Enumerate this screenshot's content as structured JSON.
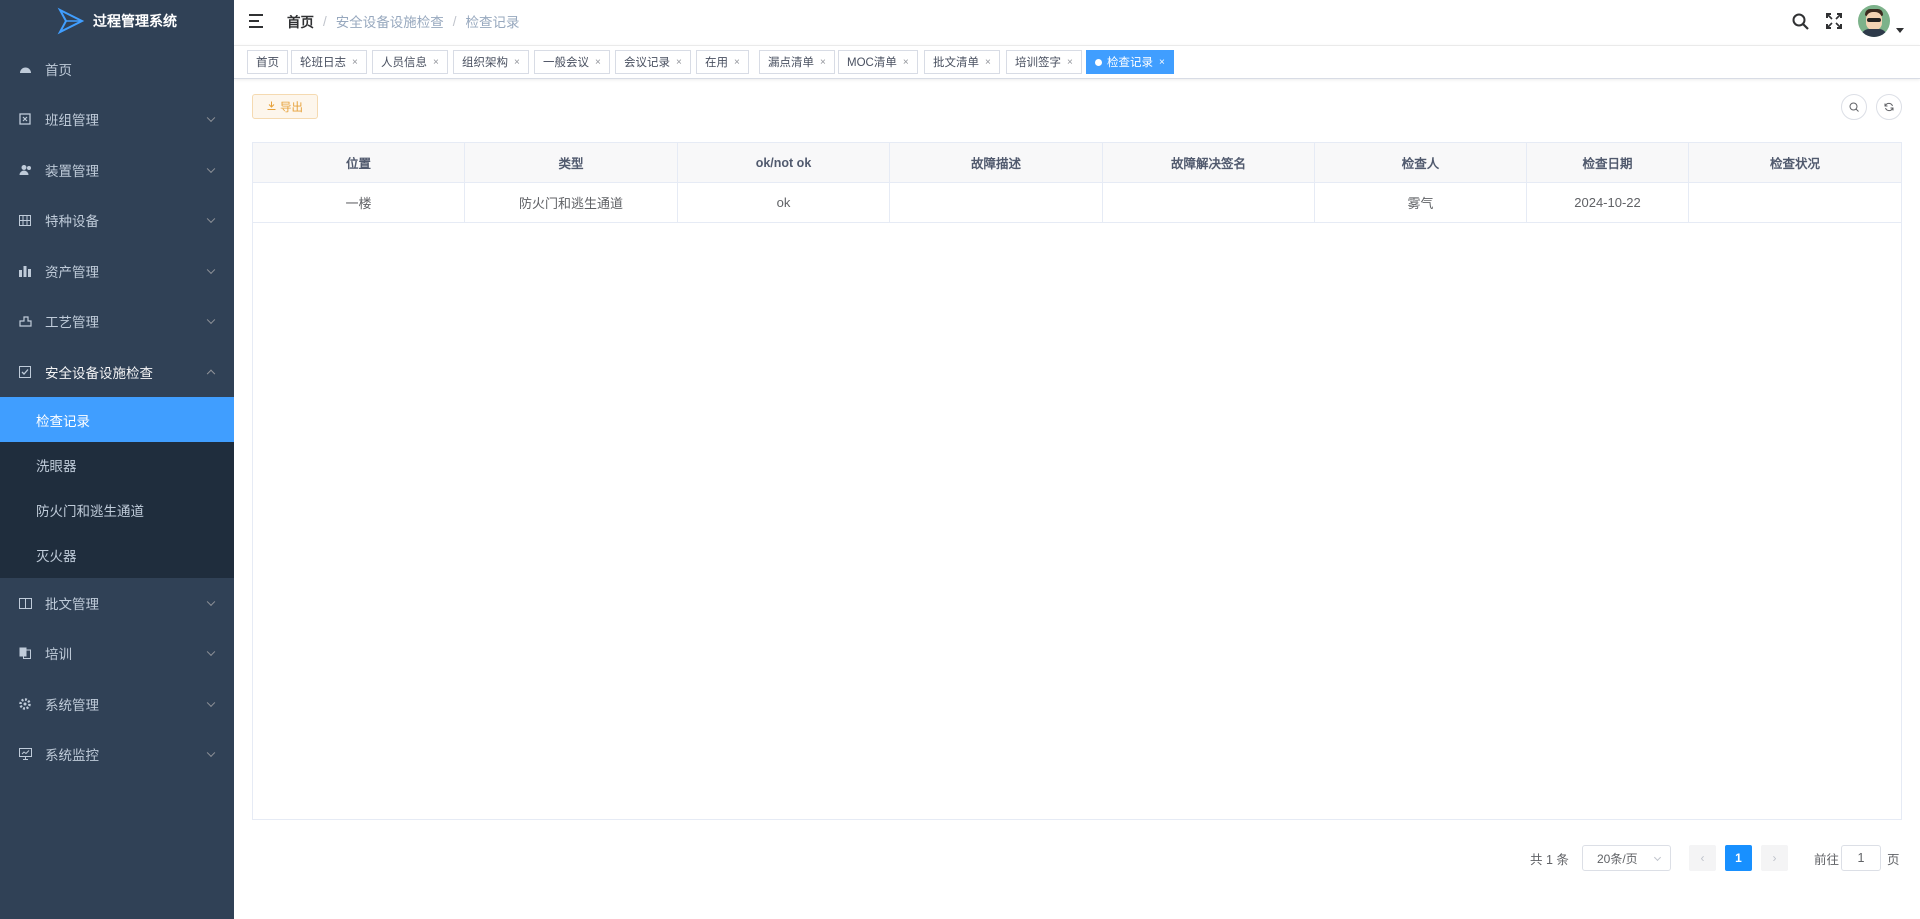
{
  "app": {
    "title": "过程管理系统"
  },
  "sidebar": {
    "items": [
      {
        "label": "首页",
        "icon": "dashboard-icon"
      },
      {
        "label": "班组管理",
        "icon": "team-icon"
      },
      {
        "label": "装置管理",
        "icon": "user-group-icon"
      },
      {
        "label": "特种设备",
        "icon": "grid-icon"
      },
      {
        "label": "资产管理",
        "icon": "bar-chart-icon"
      },
      {
        "label": "工艺管理",
        "icon": "process-icon"
      },
      {
        "label": "安全设备设施检查",
        "icon": "checkbox-icon"
      },
      {
        "label": "批文管理",
        "icon": "book-icon"
      },
      {
        "label": "培训",
        "icon": "copy-icon"
      },
      {
        "label": "系统管理",
        "icon": "settings-icon"
      },
      {
        "label": "系统监控",
        "icon": "monitor-icon"
      }
    ],
    "submenu": [
      {
        "label": "检查记录"
      },
      {
        "label": "洗眼器"
      },
      {
        "label": "防火门和逃生通道"
      },
      {
        "label": "灭火器"
      }
    ]
  },
  "breadcrumb": [
    "首页",
    "安全设备设施检查",
    "检查记录"
  ],
  "tags": [
    {
      "label": "首页",
      "closable": false
    },
    {
      "label": "轮班日志",
      "closable": true
    },
    {
      "label": "人员信息",
      "closable": true
    },
    {
      "label": "组织架构",
      "closable": true
    },
    {
      "label": "一般会议",
      "closable": true
    },
    {
      "label": "会议记录",
      "closable": true
    },
    {
      "label": "在用",
      "closable": true
    },
    {
      "label": "漏点清单",
      "closable": true
    },
    {
      "label": "MOC清单",
      "closable": true
    },
    {
      "label": "批文清单",
      "closable": true
    },
    {
      "label": "培训签字",
      "closable": true
    },
    {
      "label": "检查记录",
      "closable": true,
      "active": true
    }
  ],
  "toolbar": {
    "export_label": "导出",
    "close_glyph": "×"
  },
  "table": {
    "columns": [
      "位置",
      "类型",
      "ok/not ok",
      "故障描述",
      "故障解决签名",
      "检查人",
      "检查日期",
      "检查状况"
    ],
    "rows": [
      [
        "一楼",
        "防火门和逃生通道",
        "ok",
        "",
        "",
        "雾气",
        "2024-10-22",
        ""
      ]
    ]
  },
  "pagination": {
    "total_label": "共 1 条",
    "page_size_label": "20条/页",
    "current_page": "1",
    "goto_label": "前往",
    "goto_value": "1",
    "page_suffix": "页"
  },
  "colors": {
    "sidebar_bg": "#304156",
    "submenu_bg": "#1f2d3d",
    "active": "#409eff",
    "warning": "#e6a23c"
  }
}
